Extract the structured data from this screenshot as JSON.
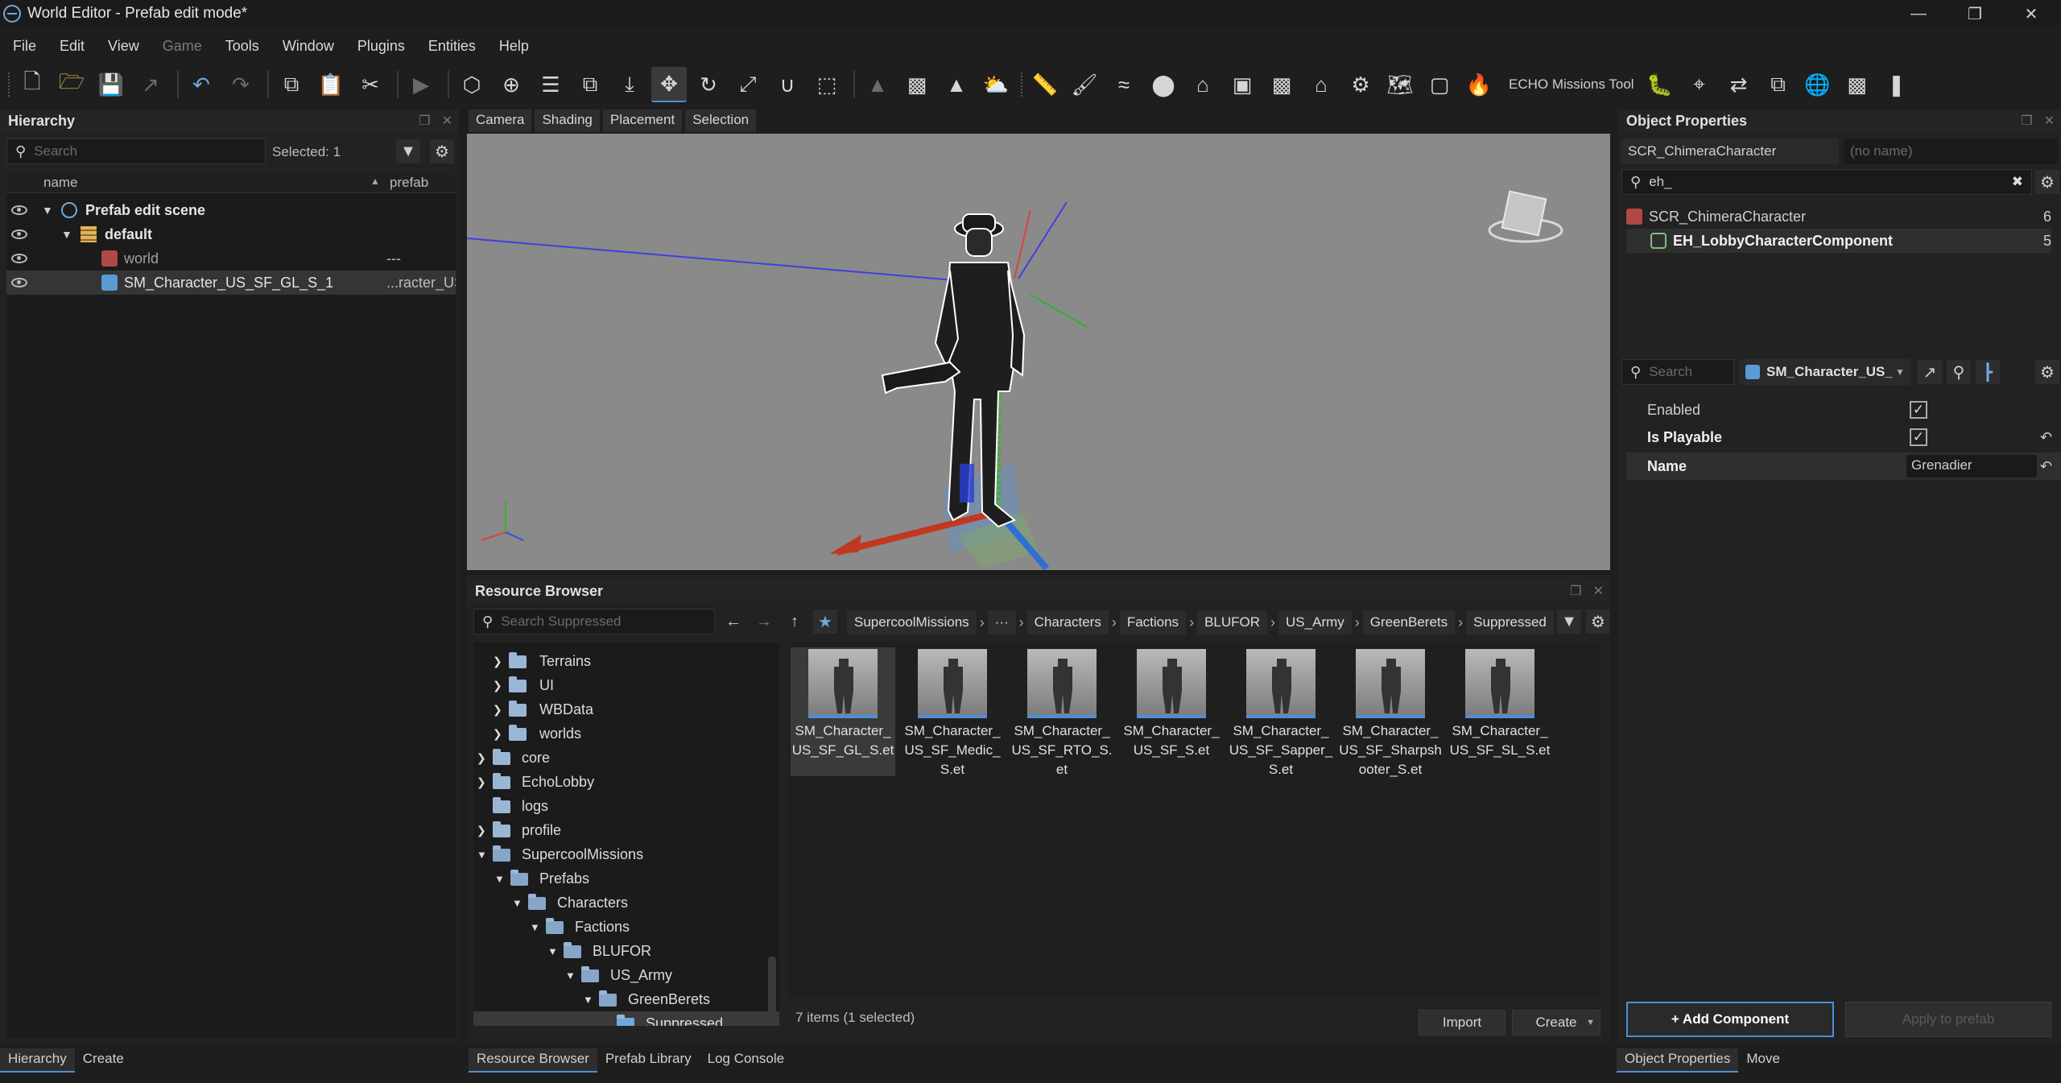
{
  "window": {
    "title": "World Editor - Prefab edit mode*"
  },
  "menu": {
    "items": [
      "File",
      "Edit",
      "View",
      "Game",
      "Tools",
      "Window",
      "Plugins",
      "Entities",
      "Help"
    ]
  },
  "toolbar": {
    "echo_label": "ECHO Missions Tool"
  },
  "hierarchy": {
    "title": "Hierarchy",
    "search_placeholder": "Search",
    "selected_text": "Selected: 1",
    "col_name": "name",
    "col_prefab": "prefab",
    "rows": [
      {
        "label": "Prefab edit scene",
        "prefab": ""
      },
      {
        "label": "default",
        "prefab": ""
      },
      {
        "label": "world",
        "prefab": "---"
      },
      {
        "label": "SM_Character_US_SF_GL_S_1",
        "prefab": "...racter_US"
      }
    ]
  },
  "viewport": {
    "tabs": [
      "Camera",
      "Shading",
      "Placement",
      "Selection"
    ]
  },
  "object_properties": {
    "title": "Object Properties",
    "class_name": "SCR_ChimeraCharacter",
    "name_placeholder": "(no name)",
    "search_value": "eh_",
    "components": [
      {
        "label": "SCR_ChimeraCharacter",
        "count": "6"
      },
      {
        "label": "EH_LobbyCharacterComponent",
        "count": "5"
      }
    ],
    "prop_search_placeholder": "Search",
    "prefab_selector": "SM_Character_US_",
    "props": [
      {
        "label": "Enabled"
      },
      {
        "label": "Is Playable"
      },
      {
        "label": "Name",
        "value": "Grenadier"
      }
    ],
    "add_component": "+ Add Component",
    "apply_to_prefab": "Apply to prefab"
  },
  "resource_browser": {
    "title": "Resource Browser",
    "search_placeholder": "Search Suppressed",
    "breadcrumb": [
      "SupercoolMissions",
      "···",
      "Characters",
      "Factions",
      "BLUFOR",
      "US_Army",
      "GreenBerets",
      "Suppressed"
    ],
    "tree": [
      {
        "label": "Terrains"
      },
      {
        "label": "UI"
      },
      {
        "label": "WBData"
      },
      {
        "label": "worlds"
      },
      {
        "label": "core"
      },
      {
        "label": "EchoLobby"
      },
      {
        "label": "logs"
      },
      {
        "label": "profile"
      },
      {
        "label": "SupercoolMissions"
      },
      {
        "label": "Prefabs"
      },
      {
        "label": "Characters"
      },
      {
        "label": "Factions"
      },
      {
        "label": "BLUFOR"
      },
      {
        "label": "US_Army"
      },
      {
        "label": "GreenBerets"
      },
      {
        "label": "Suppressed"
      }
    ],
    "assets": [
      {
        "label": "SM_Character_US_SF_GL_S.et"
      },
      {
        "label": "SM_Character_US_SF_Medic_S.et"
      },
      {
        "label": "SM_Character_US_SF_RTO_S.et"
      },
      {
        "label": "SM_Character_US_SF_S.et"
      },
      {
        "label": "SM_Character_US_SF_Sapper_S.et"
      },
      {
        "label": "SM_Character_US_SF_Sharpshooter_S.et"
      },
      {
        "label": "SM_Character_US_SF_SL_S.et"
      }
    ],
    "status": "7 items (1 selected)",
    "import_label": "Import",
    "create_label": "Create"
  },
  "bottom_tabs": {
    "left": [
      "Hierarchy",
      "Create"
    ],
    "center": [
      "Resource Browser",
      "Prefab Library",
      "Log Console"
    ],
    "right": [
      "Object Properties",
      "Move"
    ]
  }
}
